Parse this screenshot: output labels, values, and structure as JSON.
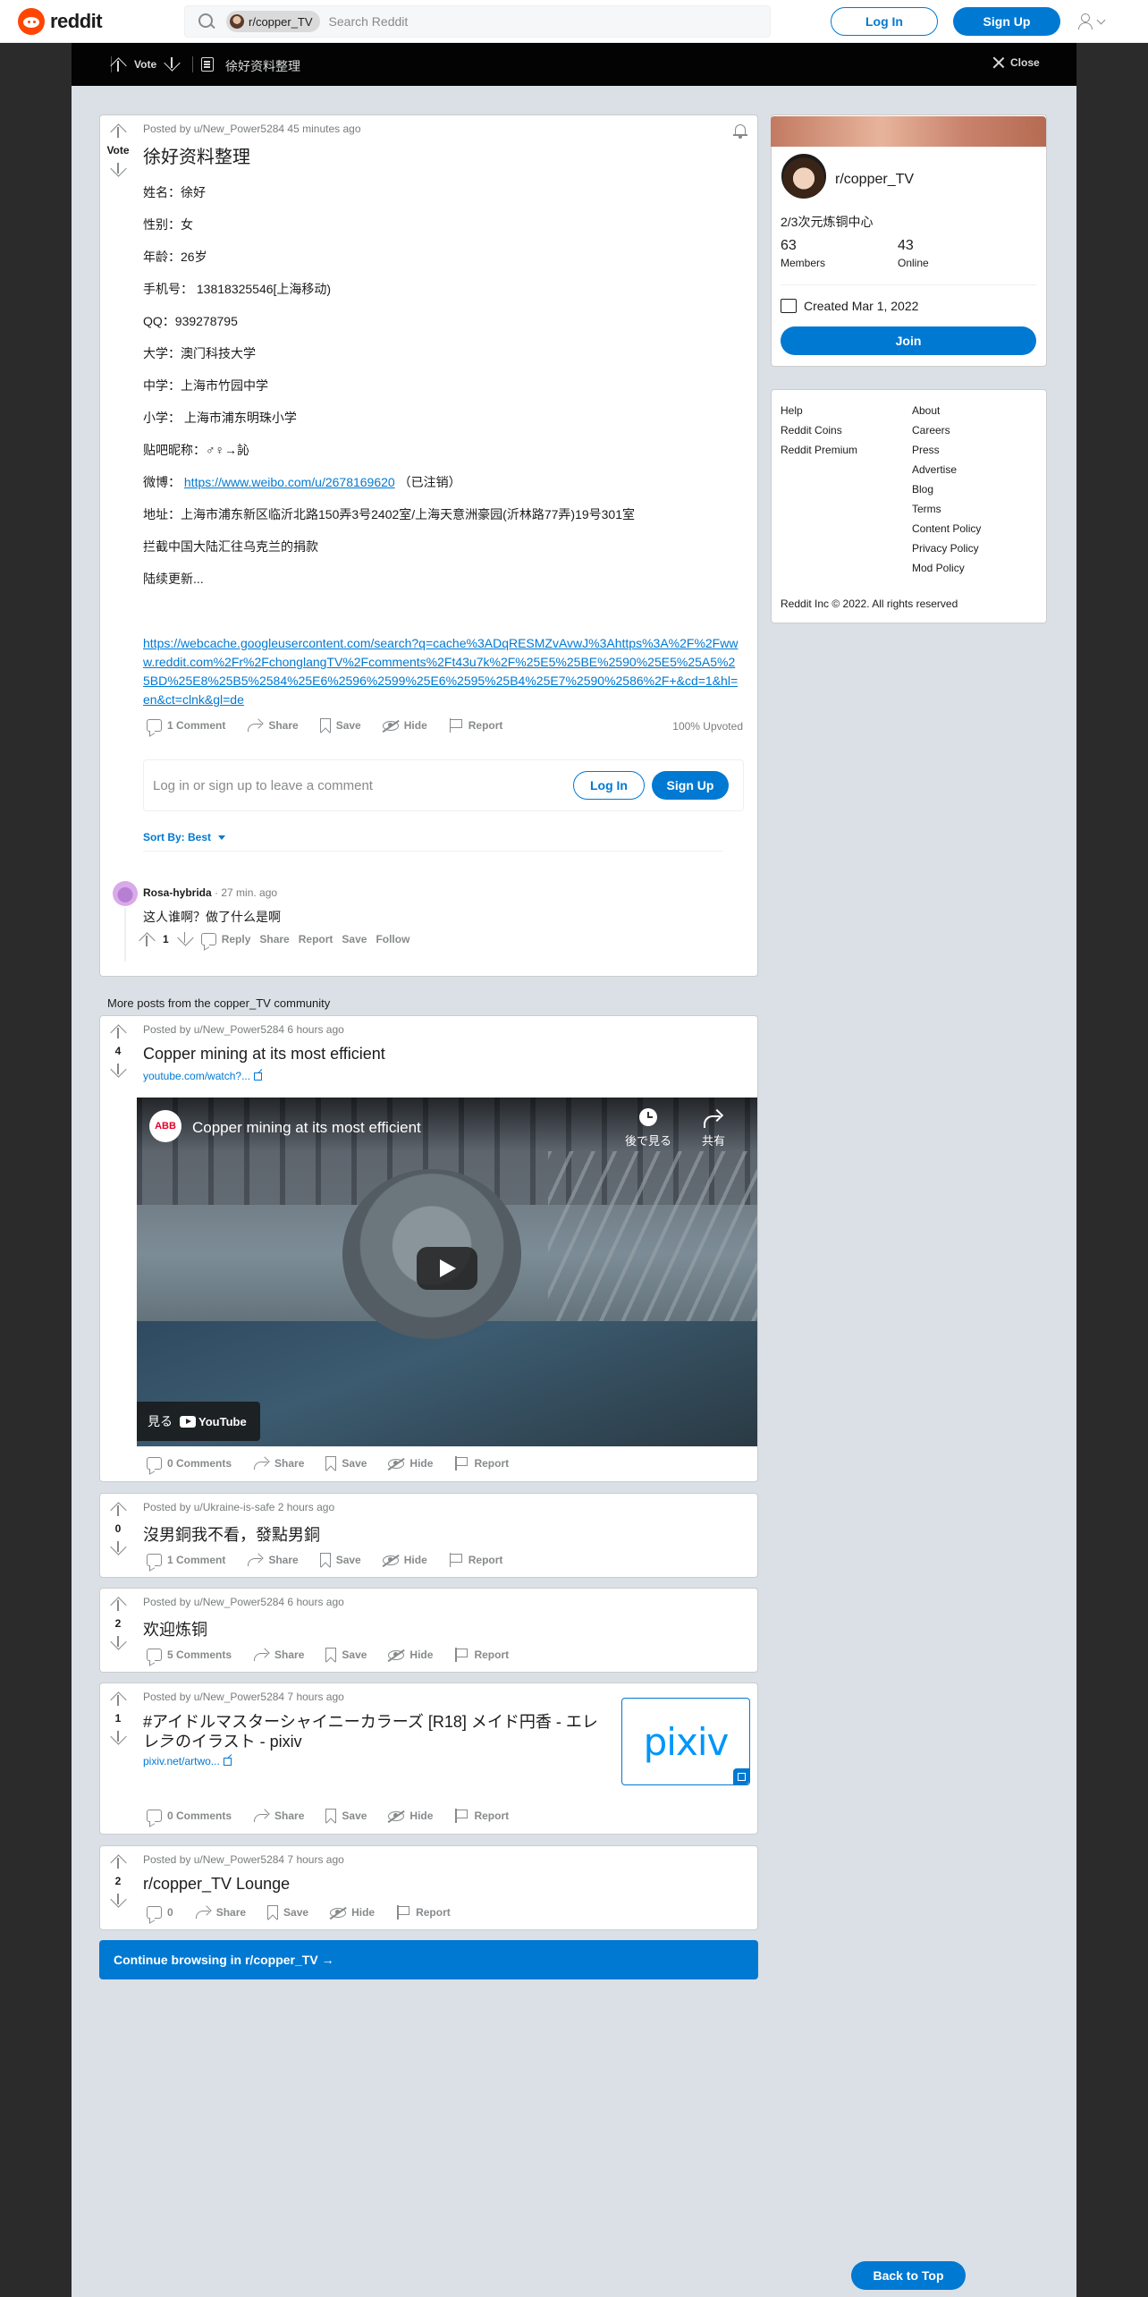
{
  "header": {
    "logo_text": "reddit",
    "search_chip": "r/copper_TV",
    "search_placeholder": "Search Reddit",
    "login_label": "Log In",
    "signup_label": "Sign Up"
  },
  "modal_bar": {
    "vote_label": "Vote",
    "post_title": "徐好资料整理",
    "close_label": "Close"
  },
  "post": {
    "meta": "Posted by u/New_Power5284 45 minutes ago",
    "vote_label": "Vote",
    "title": "徐好资料整理",
    "lines": [
      "姓名：徐好",
      "性别：女",
      "年龄：26岁",
      "手机号： 13818325546[上海移动)",
      "QQ：939278795",
      "大学：澳门科技大学",
      "中学：上海市竹园中学",
      "小学： 上海市浦东明珠小学",
      "贴吧昵称：♂♀→訫"
    ],
    "weibo_prefix": "微博：",
    "weibo_link": "https://www.weibo.com/u/2678169620",
    "weibo_suffix": "（已注销）",
    "address": "地址：上海市浦东新区临沂北路150弄3号2402室/上海天意洲豪园(沂林路77弄)19号301室",
    "line_intercept": "拦截中国大陆汇往乌克兰的捐款",
    "line_update": "陆续更新...",
    "cache_link": "https://webcache.googleusercontent.com/search?q=cache%3ADqRESMZvAvwJ%3Ahttps%3A%2F%2Fwww.reddit.com%2Fr%2FchonglangTV%2Fcomments%2Ft43u7k%2F%25E5%25BE%2590%25E5%25A5%25BD%25E8%25B5%2584%25E6%2596%2599%25E6%2595%25B4%25E7%2590%2586%2F+&cd=1&hl=en&ct=clnk&gl=de",
    "comments_label": "1 Comment",
    "share_label": "Share",
    "save_label": "Save",
    "hide_label": "Hide",
    "report_label": "Report",
    "upvoted": "100% Upvoted",
    "comment_prompt": "Log in or sign up to leave a comment",
    "login_label": "Log In",
    "signup_label": "Sign Up",
    "sort_label": "Sort By: Best"
  },
  "comment": {
    "author": "Rosa-hybrida",
    "time": "· 27 min. ago",
    "text": "这人谁啊？做了什么是啊",
    "votes": "1",
    "reply": "Reply",
    "share": "Share",
    "report": "Report",
    "save": "Save",
    "follow": "Follow"
  },
  "more_posts_heading": "More posts from the copper_TV community",
  "more_posts": [
    {
      "meta": "Posted by u/New_Power5284 6 hours ago",
      "votes": "4",
      "title": "Copper mining at its most efficient",
      "link": "youtube.com/watch?...",
      "comments": "0 Comments",
      "video_title": "Copper mining at its most efficient",
      "video_watch_later": "後で見る",
      "video_share": "共有",
      "video_watch_on": "見る",
      "video_youtube": "YouTube",
      "video_brand": "ABB"
    },
    {
      "meta": "Posted by u/Ukraine-is-safe 2 hours ago",
      "votes": "0",
      "title": "沒男銅我不看，發點男銅",
      "comments": "1 Comment"
    },
    {
      "meta": "Posted by u/New_Power5284 6 hours ago",
      "votes": "2",
      "title": "欢迎炼铜",
      "comments": "5 Comments"
    },
    {
      "meta": "Posted by u/New_Power5284 7 hours ago",
      "votes": "1",
      "title_line1": "#アイドルマスターシャイニーカラーズ [R18] メイド円香 - エレ",
      "title_line2": "レ𛀀のイラスト - pixiv",
      "link": "pixiv.net/artwo...",
      "comments": "0 Comments",
      "thumb_text": "pixiv"
    },
    {
      "meta": "Posted by u/New_Power5284 7 hours ago",
      "votes": "2",
      "title": "r/copper_TV Lounge",
      "comments": "0"
    }
  ],
  "continue_label": "Continue browsing in r/copper_TV →",
  "sidebar": {
    "community_name": "r/copper_TV",
    "description": "2/3次元炼铜中心",
    "members_count": "63",
    "members_label": "Members",
    "online_count": "43",
    "online_label": "Online",
    "created": "Created Mar 1, 2022",
    "join_label": "Join",
    "links_left": [
      "Help",
      "Reddit Coins",
      "Reddit Premium"
    ],
    "links_right": [
      "About",
      "Careers",
      "Press",
      "Advertise",
      "Blog",
      "Terms",
      "Content Policy",
      "Privacy Policy",
      "Mod Policy"
    ],
    "copyright": "Reddit Inc © 2022. All rights reserved"
  },
  "back_to_top": "Back to Top",
  "colors": {
    "brand": "#ff4500",
    "accent": "#0079d3",
    "modal_bg": "#dae0e6"
  }
}
